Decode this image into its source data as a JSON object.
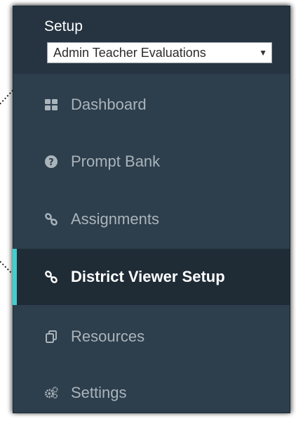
{
  "setup": {
    "label": "Setup",
    "selected_value": "Admin Teacher Evaluations"
  },
  "nav": [
    {
      "label": "Dashboard",
      "icon": "dashboard-grid-icon",
      "active": false
    },
    {
      "label": "Prompt Bank",
      "icon": "question-circle-icon",
      "active": false
    },
    {
      "label": "Assignments",
      "icon": "link-icon",
      "active": false
    },
    {
      "label": "District Viewer Setup",
      "icon": "link-icon",
      "active": true
    },
    {
      "label": "Resources",
      "icon": "copy-pages-icon",
      "active": false
    },
    {
      "label": "Settings",
      "icon": "cogs-icon",
      "active": false
    }
  ],
  "colors": {
    "sidebar_bg": "#2d3e4c",
    "setup_bg": "#253440",
    "active_bg": "#1f2c36",
    "accent": "#3dd0cf",
    "muted_text": "#aab4bb"
  }
}
